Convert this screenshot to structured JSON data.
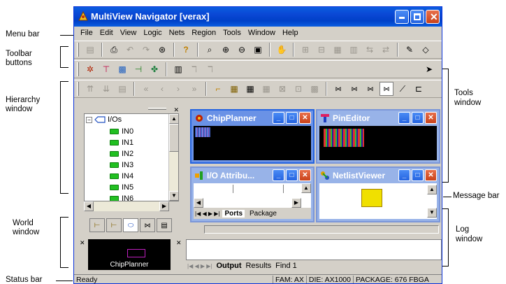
{
  "annotations": {
    "menu_bar": "Menu bar",
    "toolbar_buttons": [
      "Toolbar",
      "buttons"
    ],
    "hierarchy_window": [
      "Hierarchy",
      "window"
    ],
    "world_window": [
      "World",
      "window"
    ],
    "status_bar": "Status bar",
    "tools_window": [
      "Tools",
      "window"
    ],
    "message_bar": "Message bar",
    "log_window": [
      "Log",
      "window"
    ]
  },
  "window": {
    "title": "MultiView Navigator [verax]"
  },
  "menu": [
    "File",
    "Edit",
    "View",
    "Logic",
    "Nets",
    "Region",
    "Tools",
    "Window",
    "Help"
  ],
  "hierarchy": {
    "root_label": "I/Os",
    "items": [
      "IN0",
      "IN1",
      "IN2",
      "IN3",
      "IN4",
      "IN5",
      "IN6"
    ]
  },
  "children": {
    "chipplanner": "ChipPlanner",
    "pineditor": "PinEditor",
    "io_attrib": "I/O Attribu...",
    "netlistviewer": "NetlistViewer",
    "io_tabs": [
      "Ports",
      "Package"
    ]
  },
  "world": {
    "thumb_label": "ChipPlanner"
  },
  "log": {
    "tabs": [
      "Output",
      "Results",
      "Find 1"
    ]
  },
  "status": {
    "text": "Ready",
    "fam": "FAM: AX",
    "die": "DIE: AX1000",
    "package": "PACKAGE: 676 FBGA"
  }
}
